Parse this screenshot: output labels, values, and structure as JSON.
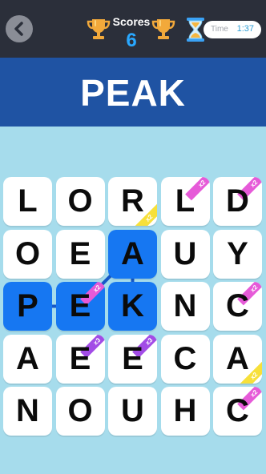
{
  "header": {
    "scores_label": "Scores",
    "score_value": "6",
    "timer_label": "Time",
    "timer_value": "1:37"
  },
  "target_word": "PEAK",
  "grid": {
    "rows": [
      [
        {
          "letter": "L"
        },
        {
          "letter": "O"
        },
        {
          "letter": "R",
          "badge": {
            "text": "x2",
            "color": "#f7e03a",
            "corner": "bl"
          }
        },
        {
          "letter": "L",
          "badge": {
            "text": "x2",
            "color": "#e65ad8",
            "corner": "tl"
          }
        },
        {
          "letter": "D",
          "badge": {
            "text": "x2",
            "color": "#e65ad8",
            "corner": "tl"
          }
        }
      ],
      [
        {
          "letter": "O"
        },
        {
          "letter": "E"
        },
        {
          "letter": "A",
          "selected": true
        },
        {
          "letter": "U"
        },
        {
          "letter": "Y"
        }
      ],
      [
        {
          "letter": "P",
          "selected": true
        },
        {
          "letter": "E",
          "selected": true,
          "badge": {
            "text": "x2",
            "color": "#e65ad8",
            "corner": "tl"
          }
        },
        {
          "letter": "K",
          "selected": true
        },
        {
          "letter": "N"
        },
        {
          "letter": "C",
          "badge": {
            "text": "x2",
            "color": "#e65ad8",
            "corner": "tl"
          }
        }
      ],
      [
        {
          "letter": "A"
        },
        {
          "letter": "E",
          "badge": {
            "text": "x3",
            "color": "#a24be6",
            "corner": "tl"
          }
        },
        {
          "letter": "E",
          "badge": {
            "text": "x3",
            "color": "#a24be6",
            "corner": "tl"
          }
        },
        {
          "letter": "C"
        },
        {
          "letter": "A",
          "badge": {
            "text": "x2",
            "color": "#f7e03a",
            "corner": "bl"
          }
        }
      ],
      [
        {
          "letter": "N"
        },
        {
          "letter": "O"
        },
        {
          "letter": "U"
        },
        {
          "letter": "H"
        },
        {
          "letter": "C",
          "badge": {
            "text": "x2",
            "color": "#e65ad8",
            "corner": "tl"
          }
        }
      ]
    ],
    "path": [
      [
        2,
        0
      ],
      [
        2,
        1
      ],
      [
        1,
        2
      ],
      [
        2,
        2
      ]
    ],
    "path_color": "#1558c8"
  },
  "colors": {
    "topbar": "#2b2f3a",
    "banner": "#1f53a3",
    "background": "#a6dcec",
    "selected_tile": "#1677f2",
    "score": "#29a8ff"
  }
}
